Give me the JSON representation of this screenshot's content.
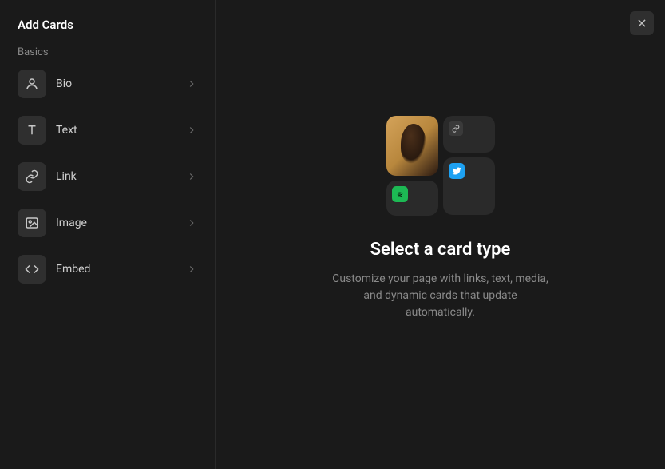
{
  "sidebar": {
    "title": "Add Cards",
    "section_label": "Basics",
    "items": [
      {
        "label": "Bio",
        "icon": "user"
      },
      {
        "label": "Text",
        "icon": "text"
      },
      {
        "label": "Link",
        "icon": "link"
      },
      {
        "label": "Image",
        "icon": "image"
      },
      {
        "label": "Embed",
        "icon": "code"
      }
    ]
  },
  "main": {
    "title": "Select a card type",
    "description": "Customize your page with links, text, media, and dynamic cards that update automatically.",
    "preview_icons": {
      "portrait": "portrait-image",
      "link": "link-icon",
      "spotify": "spotify-icon",
      "twitter": "twitter-icon"
    }
  }
}
